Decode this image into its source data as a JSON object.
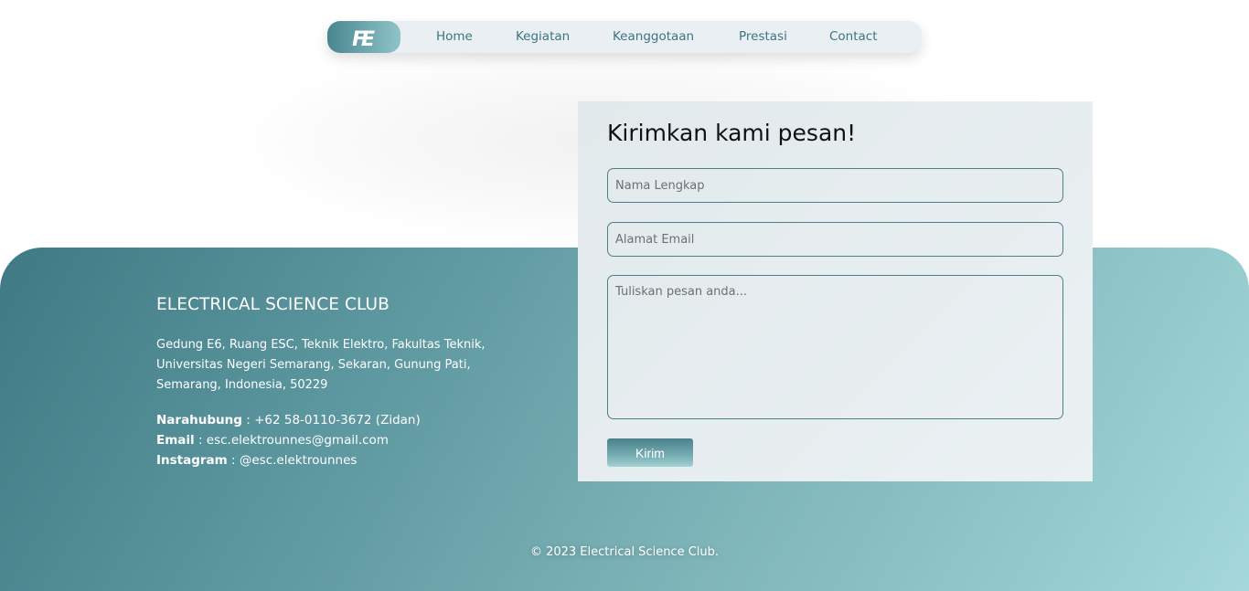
{
  "nav": {
    "logo_text": "FE",
    "links": [
      "Home",
      "Kegiatan",
      "Keanggotaan",
      "Prestasi",
      "Contact"
    ]
  },
  "form": {
    "title": "Kirimkan kami pesan!",
    "name_placeholder": "Nama Lengkap",
    "email_placeholder": "Alamat Email",
    "message_placeholder": "Tuliskan pesan anda...",
    "submit_label": "Kirim"
  },
  "footer": {
    "org_name": "ELECTRICAL SCIENCE CLUB",
    "address_lines": [
      "Gedung E6, Ruang ESC, Teknik Elektro, Fakultas Teknik,",
      "Universitas Negeri Semarang, Sekaran, Gunung Pati,",
      "Semarang, Indonesia, 50229"
    ],
    "contacts": [
      {
        "label": "Narahubung",
        "sep": " : ",
        "value": "+62 58-0110-3672 (Zidan)"
      },
      {
        "label": "Email",
        "sep": " : ",
        "value": "esc.elektrounnes@gmail.com"
      },
      {
        "label": "Instagram",
        "sep": " : ",
        "value": "@esc.elektrounnes"
      }
    ],
    "copyright": "© 2023 Electrical Science Club."
  },
  "colors": {
    "accent": "#4a8690",
    "nav_bg": "#e9eff2",
    "nav_link": "#3f7480",
    "footer_start": "#3f7a84",
    "footer_end": "#a4d8da",
    "form_bg": "#e7eef1",
    "field_border": "#4b7f89"
  }
}
